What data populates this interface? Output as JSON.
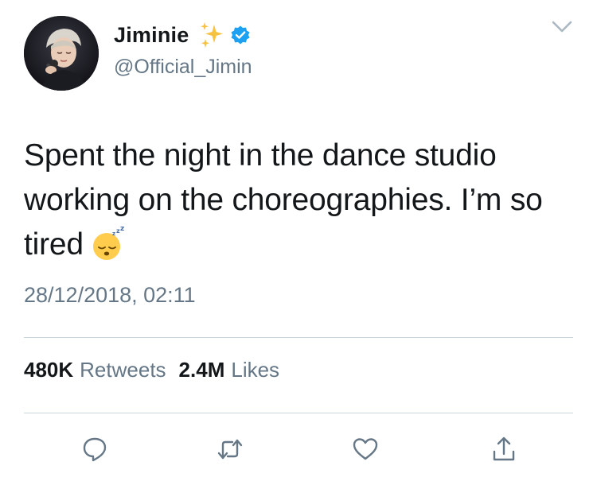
{
  "user": {
    "display_name": "Jiminie",
    "handle": "@Official_Jimin",
    "verified": true,
    "name_decoration_icon": "sparkles-icon",
    "avatar_icon": "avatar-photo"
  },
  "tweet": {
    "text": "Spent the night in the dance studio working on the choreographies. I’m so tired",
    "emoji_icon": "sleeping-face-emoji",
    "timestamp": "28/12/2018, 02:11"
  },
  "stats": {
    "retweets_count": "480K",
    "retweets_label": "Retweets",
    "likes_count": "2.4M",
    "likes_label": "Likes"
  },
  "actions": [
    {
      "icon": "reply-icon"
    },
    {
      "icon": "retweet-icon"
    },
    {
      "icon": "like-icon"
    },
    {
      "icon": "share-icon"
    }
  ],
  "colors": {
    "primary_text": "#14171a",
    "secondary_text": "#657786",
    "verified_blue": "#1da1f2",
    "divider": "#ccd6dd",
    "sparkle_gold": "#f5c242"
  }
}
